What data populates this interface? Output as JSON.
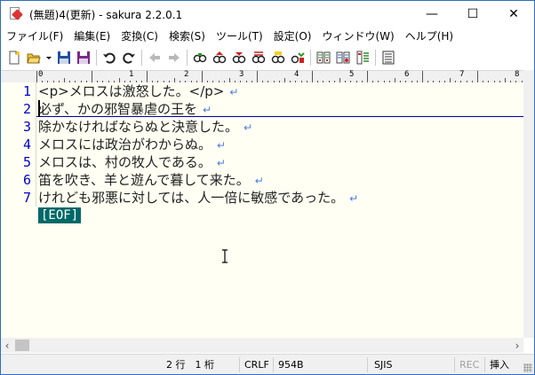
{
  "window": {
    "title": "(無題)4(更新) - sakura 2.2.0.1",
    "minimize_glyph": "—",
    "maximize_glyph": "☐",
    "close_glyph": "✕"
  },
  "menu": [
    {
      "label": "ファイル(F)"
    },
    {
      "label": "編集(E)"
    },
    {
      "label": "変換(C)"
    },
    {
      "label": "検索(S)"
    },
    {
      "label": "ツール(T)"
    },
    {
      "label": "設定(O)"
    },
    {
      "label": "ウィンドウ(W)"
    },
    {
      "label": "ヘルプ(H)"
    }
  ],
  "toolbar": {
    "icons": [
      "new-file-icon",
      "open-folder-icon",
      "dropdown-arrow-icon",
      "save-icon",
      "save-all-icon",
      "undo-icon",
      "redo-icon",
      "jump-back-icon",
      "jump-forward-icon",
      "search-icon",
      "search-prev-icon",
      "search-next-icon",
      "replace-icon",
      "highlight-icon",
      "search-box-icon",
      "compare-icon",
      "grep-icon",
      "outline-icon",
      "print-icon"
    ]
  },
  "ruler": {
    "labels": [
      "0",
      "1",
      "2",
      "3",
      "4",
      "5",
      "6",
      "7",
      "8"
    ]
  },
  "editor": {
    "lines": [
      {
        "num": "1",
        "text": "<p>メロスは激怒した。</p>"
      },
      {
        "num": "2",
        "text": "必ず、かの邪智暴虐の王を"
      },
      {
        "num": "3",
        "text": "除かなければならぬと決意した。"
      },
      {
        "num": "4",
        "text": "メロスには政治がわからぬ。"
      },
      {
        "num": "5",
        "text": "メロスは、村の牧人である。"
      },
      {
        "num": "6",
        "text": "笛を吹き、羊と遊んで暮して来た。"
      },
      {
        "num": "7",
        "text": "けれども邪悪に対しては、人一倍に敏感であった。"
      }
    ],
    "return_mark": "↵",
    "eof_mark": "[EOF]"
  },
  "statusbar": {
    "position": "2 行　1 桁",
    "line_ending": "CRLF",
    "char_code_value": "954B",
    "encoding": "SJIS",
    "rec": "REC",
    "insert_mode": "挿入"
  },
  "colors": {
    "line_number": "#0000c8",
    "editor_bg": "#fffff3",
    "eof_bg": "#006868",
    "return_mark": "#4b7de0"
  }
}
